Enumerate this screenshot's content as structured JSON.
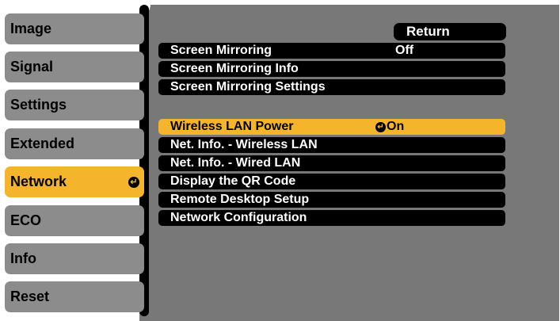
{
  "tabs": [
    {
      "label": "Image"
    },
    {
      "label": "Signal"
    },
    {
      "label": "Settings"
    },
    {
      "label": "Extended"
    },
    {
      "label": "Network",
      "selected": true,
      "icon": "enter-icon"
    },
    {
      "label": "ECO"
    },
    {
      "label": "Info"
    },
    {
      "label": "Reset"
    }
  ],
  "return_label": "Return",
  "menu": {
    "items": [
      {
        "label": "Screen Mirroring",
        "value": "Off"
      },
      {
        "label": "Screen Mirroring Info"
      },
      {
        "label": "Screen Mirroring Settings"
      },
      {
        "label": "Wireless LAN Power",
        "value": "On",
        "value_icon": "enter-icon",
        "highlighted": true
      },
      {
        "label": "Net. Info. - Wireless LAN"
      },
      {
        "label": "Net. Info. - Wired LAN"
      },
      {
        "label": "Display the QR Code"
      },
      {
        "label": "Remote Desktop Setup"
      },
      {
        "label": "Network Configuration"
      }
    ]
  },
  "colors": {
    "accent": "#f4b52c",
    "tab_bg": "#8c8c8c",
    "panel_bg": "#787878",
    "row_bg": "#000000",
    "text_light": "#ffffff"
  }
}
